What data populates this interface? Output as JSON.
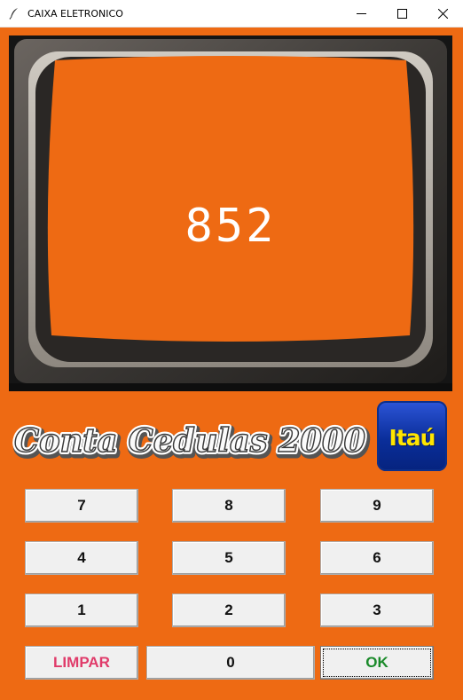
{
  "window": {
    "title": "CAIXA ELETRONICO",
    "icon": "feather-icon",
    "controls": [
      "minimize-icon",
      "maximize-icon",
      "close-icon"
    ]
  },
  "screen": {
    "display_value": "852",
    "screen_color": "#ee6a13"
  },
  "brand": {
    "logo_text": "Conta Cedulas 2000",
    "bank_logo_text": "Itaú",
    "bank_logo_color": "#ffe500"
  },
  "keypad": {
    "rows": [
      [
        "7",
        "8",
        "9"
      ],
      [
        "4",
        "5",
        "6"
      ],
      [
        "1",
        "2",
        "3"
      ]
    ],
    "clear_label": "LIMPAR",
    "zero_label": "0",
    "ok_label": "OK",
    "clear_color": "#e03b6a",
    "ok_color": "#1a8a2a"
  }
}
